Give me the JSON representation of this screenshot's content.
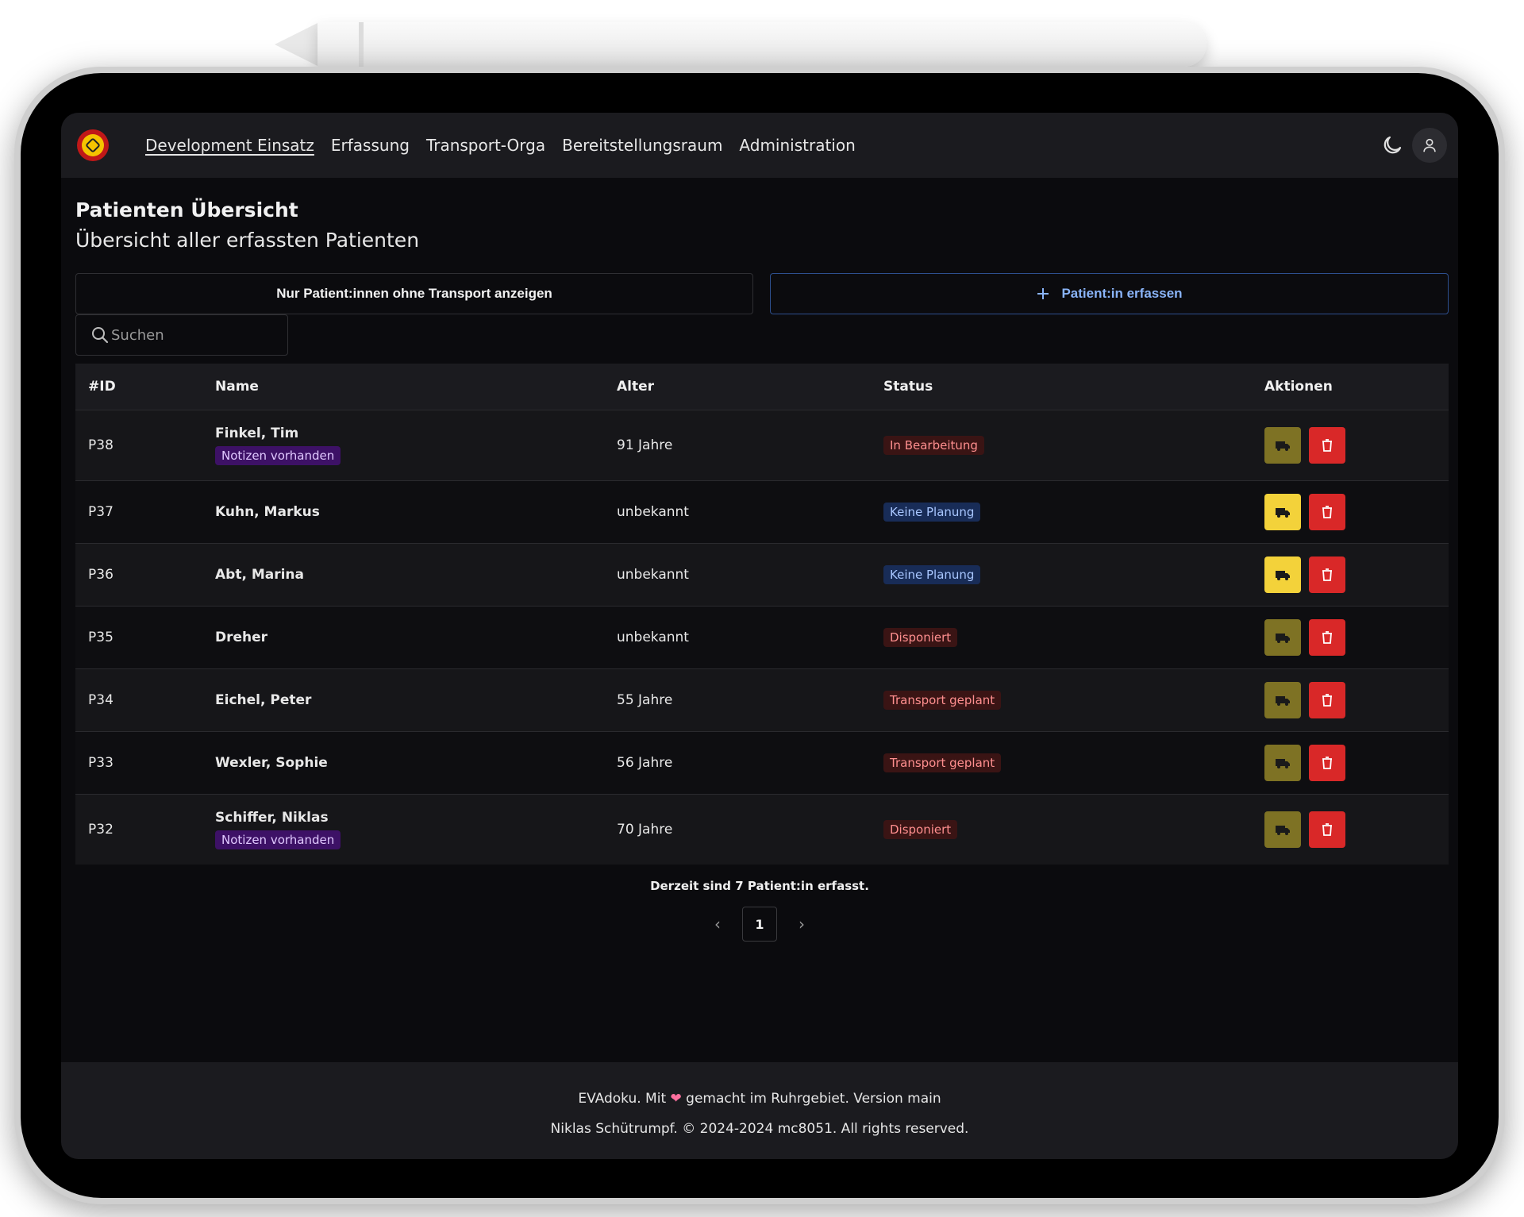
{
  "nav": {
    "brand_alt": "logo",
    "links": [
      {
        "label": "Development Einsatz"
      },
      {
        "label": "Erfassung"
      },
      {
        "label": "Transport-Orga"
      },
      {
        "label": "Bereitstellungsraum"
      },
      {
        "label": "Administration"
      }
    ]
  },
  "header": {
    "title": "Patienten Übersicht",
    "subtitle": "Übersicht aller erfassten Patienten"
  },
  "actions": {
    "filter_label": "Nur Patient:innen ohne Transport anzeigen",
    "add_label": "Patient:in erfassen"
  },
  "search": {
    "placeholder": "Suchen"
  },
  "table": {
    "headers": {
      "id": "#ID",
      "name": "Name",
      "age": "Alter",
      "status": "Status",
      "actions": "Aktionen"
    },
    "rows": [
      {
        "id": "P38",
        "name": "Finkel, Tim",
        "note": "Notizen vorhanden",
        "age": "91 Jahre",
        "status": "In Bearbeitung"
      },
      {
        "id": "P37",
        "name": "Kuhn, Markus",
        "note": "",
        "age": "unbekannt",
        "status": "Keine Planung"
      },
      {
        "id": "P36",
        "name": "Abt, Marina",
        "note": "",
        "age": "unbekannt",
        "status": "Keine Planung"
      },
      {
        "id": "P35",
        "name": "Dreher",
        "note": "",
        "age": "unbekannt",
        "status": "Disponiert"
      },
      {
        "id": "P34",
        "name": "Eichel, Peter",
        "note": "",
        "age": "55 Jahre",
        "status": "Transport geplant"
      },
      {
        "id": "P33",
        "name": "Wexler, Sophie",
        "note": "",
        "age": "56 Jahre",
        "status": "Transport geplant"
      },
      {
        "id": "P32",
        "name": "Schiffer, Niklas",
        "note": "Notizen vorhanden",
        "age": "70 Jahre",
        "status": "Disponiert"
      }
    ]
  },
  "summary": {
    "count_text": "Derzeit sind 7 Patient:in erfasst."
  },
  "pagination": {
    "current": "1",
    "prev": "‹",
    "next": "›"
  },
  "footer": {
    "line1_prefix": "EVAdoku. Mit",
    "line1_suffix": "gemacht im Ruhrgebiet. Version main",
    "line2": "Niklas Schütrumpf. © 2024-2024 mc8051. All rights reserved."
  },
  "colors": {
    "accent_blue": "#8ab4f8",
    "transport_active": "#f3d23a",
    "transport_inactive": "#7e7224",
    "delete": "#d92828",
    "notes_badge": "#3d1166"
  },
  "icons": {
    "theme": "moon-icon",
    "user": "user-icon",
    "search": "search-icon",
    "add": "plus-icon",
    "transport": "ambulance-icon",
    "delete": "trash-icon",
    "footer": "heart-icon"
  }
}
